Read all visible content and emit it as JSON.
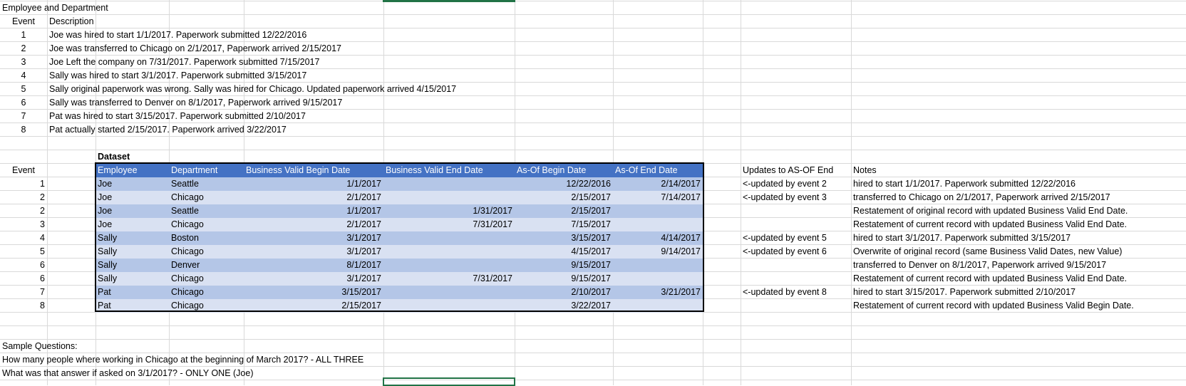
{
  "title": "Employee and Department",
  "desc_header": {
    "event": "Event",
    "description": "Description"
  },
  "events": [
    {
      "n": "1",
      "text": "Joe was hired to start 1/1/2017.  Paperwork submitted 12/22/2016"
    },
    {
      "n": "2",
      "text": "Joe was transferred to Chicago on 2/1/2017, Paperwork arrived 2/15/2017"
    },
    {
      "n": "3",
      "text": "Joe Left the company on 7/31/2017.  Paperwork submitted 7/15/2017"
    },
    {
      "n": "4",
      "text": "Sally was hired to start 3/1/2017.  Paperwork submitted 3/15/2017"
    },
    {
      "n": "5",
      "text": "Sally original paperwork was wrong.  Sally was hired for Chicago.  Updated paperwork arrived 4/15/2017"
    },
    {
      "n": "6",
      "text": "Sally was transferred to Denver on 8/1/2017, Paperwork arrived 9/15/2017"
    },
    {
      "n": "7",
      "text": "Pat was hired to start 3/15/2017.  Paperwork submitted 2/10/2017"
    },
    {
      "n": "8",
      "text": "Pat actually started 2/15/2017.  Paperwork arrived 3/22/2017"
    }
  ],
  "dataset_label": "Dataset",
  "table": {
    "event_label": "Event",
    "headers": [
      "Employee",
      "Department",
      "Business Valid Begin Date",
      "Business Valid End Date",
      "As-Of Begin Date",
      "As-Of End Date"
    ],
    "updates_header": "Updates to AS-OF End",
    "notes_header": "Notes",
    "rows": [
      {
        "event": "1",
        "employee": "Joe",
        "department": "Seattle",
        "bv_begin": "1/1/2017",
        "bv_end": "",
        "asof_begin": "12/22/2016",
        "asof_end": "2/14/2017",
        "update": "<-updated by event 2",
        "note": "hired to start 1/1/2017.  Paperwork submitted 12/22/2016"
      },
      {
        "event": "2",
        "employee": "Joe",
        "department": "Chicago",
        "bv_begin": "2/1/2017",
        "bv_end": "",
        "asof_begin": "2/15/2017",
        "asof_end": "7/14/2017",
        "update": "<-updated by event 3",
        "note": "transferred to Chicago on 2/1/2017, Paperwork arrived 2/15/2017"
      },
      {
        "event": "2",
        "employee": "Joe",
        "department": "Seattle",
        "bv_begin": "1/1/2017",
        "bv_end": "1/31/2017",
        "asof_begin": "2/15/2017",
        "asof_end": "",
        "update": "",
        "note": "Restatement of original record with updated Business Valid End Date."
      },
      {
        "event": "3",
        "employee": "Joe",
        "department": "Chicago",
        "bv_begin": "2/1/2017",
        "bv_end": "7/31/2017",
        "asof_begin": "7/15/2017",
        "asof_end": "",
        "update": "",
        "note": "Restatement of current record with updated Business Valid End Date."
      },
      {
        "event": "4",
        "employee": "Sally",
        "department": "Boston",
        "bv_begin": "3/1/2017",
        "bv_end": "",
        "asof_begin": "3/15/2017",
        "asof_end": "4/14/2017",
        "update": "<-updated by event 5",
        "note": "hired to start 3/1/2017.  Paperwork submitted 3/15/2017"
      },
      {
        "event": "5",
        "employee": "Sally",
        "department": "Chicago",
        "bv_begin": "3/1/2017",
        "bv_end": "",
        "asof_begin": "4/15/2017",
        "asof_end": "9/14/2017",
        "update": "<-updated by event 6",
        "note": "Overwrite of original record (same Business Valid Dates, new Value)"
      },
      {
        "event": "6",
        "employee": "Sally",
        "department": "Denver",
        "bv_begin": "8/1/2017",
        "bv_end": "",
        "asof_begin": "9/15/2017",
        "asof_end": "",
        "update": "",
        "note": "transferred to Denver on 8/1/2017, Paperwork arrived 9/15/2017"
      },
      {
        "event": "6",
        "employee": "Sally",
        "department": "Chicago",
        "bv_begin": "3/1/2017",
        "bv_end": "7/31/2017",
        "asof_begin": "9/15/2017",
        "asof_end": "",
        "update": "",
        "note": "Restatement of current record with updated Business Valid End Date."
      },
      {
        "event": "7",
        "employee": "Pat",
        "department": "Chicago",
        "bv_begin": "3/15/2017",
        "bv_end": "",
        "asof_begin": "2/10/2017",
        "asof_end": "3/21/2017",
        "update": "<-updated by event 8",
        "note": "hired to start 3/15/2017.  Paperwork submitted 2/10/2017"
      },
      {
        "event": "8",
        "employee": "Pat",
        "department": "Chicago",
        "bv_begin": "2/15/2017",
        "bv_end": "",
        "asof_begin": "3/22/2017",
        "asof_end": "",
        "update": "",
        "note": "Restatement of current record with updated Business Valid Begin Date."
      }
    ]
  },
  "questions": {
    "label": "Sample Questions:",
    "q1": "How many people where working in Chicago at the beginning of March 2017? - ALL THREE",
    "q2": "What was that answer if asked on 3/1/2017? - ONLY ONE (Joe)"
  },
  "colors": {
    "header_fill": "#4472c4",
    "band_dark": "#b4c6e7",
    "band_light": "#d9e1f2",
    "gridline": "#d9d9d9",
    "selection": "#217346"
  }
}
